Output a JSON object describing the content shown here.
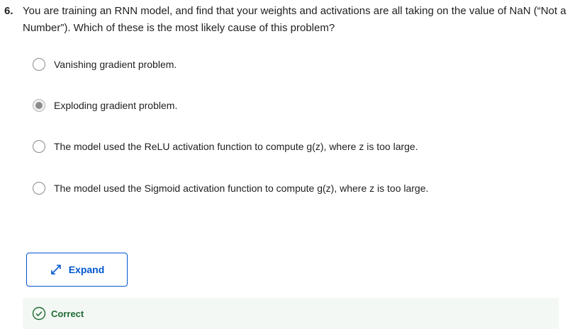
{
  "question": {
    "number": "6.",
    "text": "You are training an RNN model, and find that your weights and activations are all taking on the value of NaN (“Not a Number”). Which of these is the most likely cause of this problem?"
  },
  "options": [
    {
      "label": "Vanishing gradient problem.",
      "selected": false
    },
    {
      "label": "Exploding gradient problem.",
      "selected": true
    },
    {
      "label": "The model used the ReLU activation function to compute g(z), where z is too large.",
      "selected": false
    },
    {
      "label": "The model used the Sigmoid activation function to compute g(z), where z is too large.",
      "selected": false
    }
  ],
  "expand_button": {
    "label": "Expand",
    "icon": "expand-arrows-icon"
  },
  "result": {
    "label": "Correct",
    "icon": "check-circle-icon"
  },
  "colors": {
    "accent": "#0056d2",
    "correct_text": "#1e6b35",
    "correct_bg": "#f4f8f4"
  }
}
